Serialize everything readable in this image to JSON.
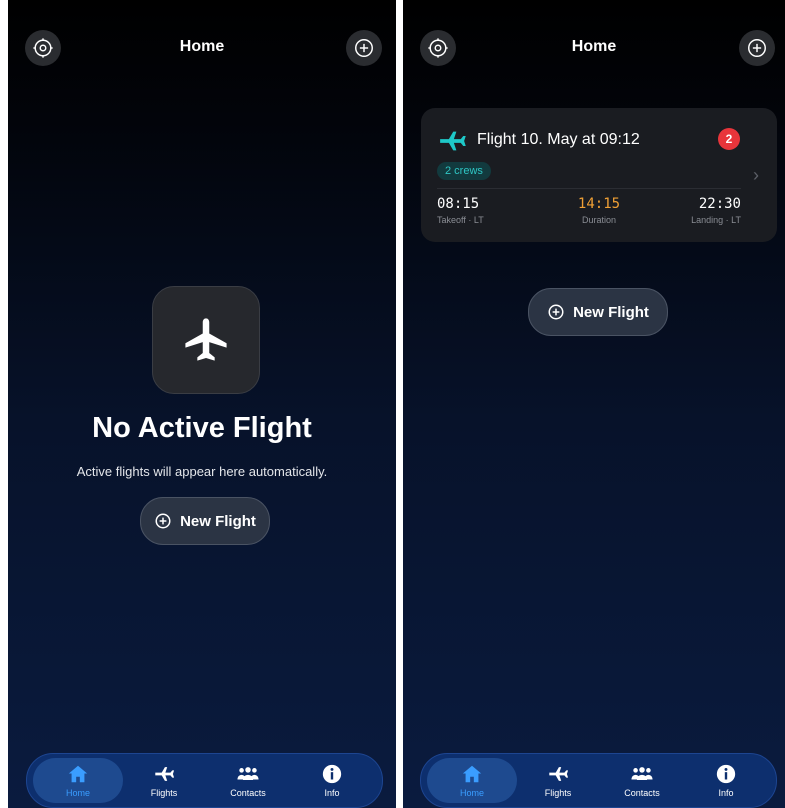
{
  "left": {
    "title": "Home",
    "empty_title": "No Active Flight",
    "empty_subtitle": "Active flights will appear here automatically.",
    "new_flight_label": "New Flight"
  },
  "right": {
    "title": "Home",
    "new_flight_label": "New Flight",
    "card": {
      "title": "Flight 10. May at 09:12",
      "badge": "2",
      "crews": "2 crews",
      "takeoff_value": "08:15",
      "takeoff_label": "Takeoff · LT",
      "duration_value": "14:15",
      "duration_label": "Duration",
      "landing_value": "22:30",
      "landing_label": "Landing · LT"
    }
  },
  "tabs": [
    {
      "label": "Home",
      "icon": "house-icon",
      "active": true
    },
    {
      "label": "Flights",
      "icon": "airplane-icon",
      "active": false
    },
    {
      "label": "Contacts",
      "icon": "people-icon",
      "active": false
    },
    {
      "label": "Info",
      "icon": "info-icon",
      "active": false
    }
  ],
  "colors": {
    "accent_teal": "#1ec8c8",
    "duration_orange": "#f0a035",
    "badge_red": "#e8353b",
    "tab_active": "#3a9dff"
  }
}
